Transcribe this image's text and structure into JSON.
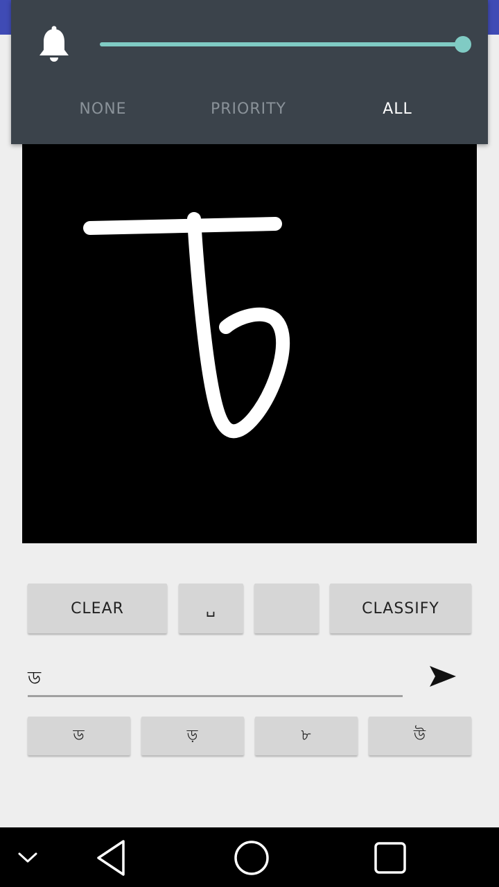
{
  "volume_panel": {
    "icon": "bell-icon",
    "level": 1.0,
    "modes": {
      "none": "NONE",
      "priority": "PRIORITY",
      "all": "ALL"
    },
    "selected_mode": "ALL",
    "accent": "#80cbc4"
  },
  "controls": {
    "clear_label": "CLEAR",
    "space_label": "␣",
    "blank_label": "",
    "classify_label": "CLASSIFY"
  },
  "input": {
    "value": "ড"
  },
  "suggestions": [
    "ড",
    "ড়",
    "৮",
    "উ"
  ],
  "navbar": {
    "icons": [
      "chevron-down-icon",
      "back-icon",
      "home-icon",
      "recents-icon"
    ]
  }
}
